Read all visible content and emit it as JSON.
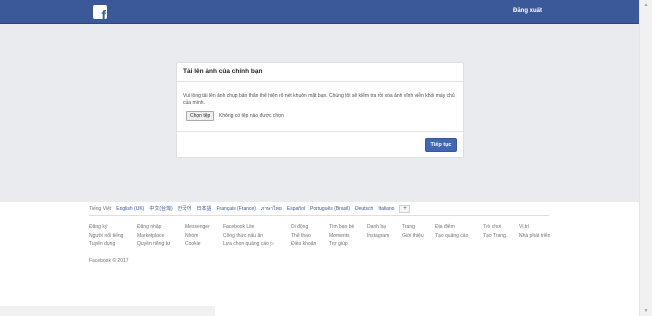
{
  "header": {
    "logo_letter": "f",
    "logout_label": "Đăng xuất"
  },
  "card": {
    "title": "Tải lên ảnh của chính bạn",
    "description": "Vui lòng tải lên ảnh chụp bản thân thể hiện rõ nét khuôn mặt bạn. Chúng tôi sẽ kiểm tra rồi xóa ảnh vĩnh viễn khỏi máy chủ của mình.",
    "choose_file_label": "Chọn tệp",
    "file_status": "Không có tệp nào được chọn",
    "continue_label": "Tiếp tục"
  },
  "footer": {
    "languages": [
      "Tiếng Việt",
      "English (UK)",
      "中文(台灣)",
      "한국어",
      "日本語",
      "Français (France)",
      "ภาษาไทย",
      "Español",
      "Português (Brasil)",
      "Deutsch",
      "Italiano"
    ],
    "more_languages": "+",
    "link_columns": [
      [
        "Đăng ký",
        "Người nổi tiếng",
        "Tuyển dụng"
      ],
      [
        "Đăng nhập",
        "Marketplace",
        "Quyền riêng tư"
      ],
      [
        "Messenger",
        "Nhóm",
        "Cookie"
      ],
      [
        "Facebook Lite",
        "Công thức nấu ăn",
        "Lựa chọn quảng cáo ▷"
      ],
      [
        "Di động",
        "Thể thao",
        "Điều khoản"
      ],
      [
        "Tìm bạn bè",
        "Moments",
        "Trợ giúp"
      ],
      [
        "Danh bạ",
        "Instagram"
      ],
      [
        "Trang",
        "Giới thiệu"
      ],
      [
        "Địa điểm",
        "Tạo quảng cáo"
      ],
      [
        "Trò chơi",
        "Tạo Trang"
      ],
      [
        "Vị trí",
        "Nhà phát triển"
      ]
    ],
    "copyright": "Facebook © 2017"
  }
}
